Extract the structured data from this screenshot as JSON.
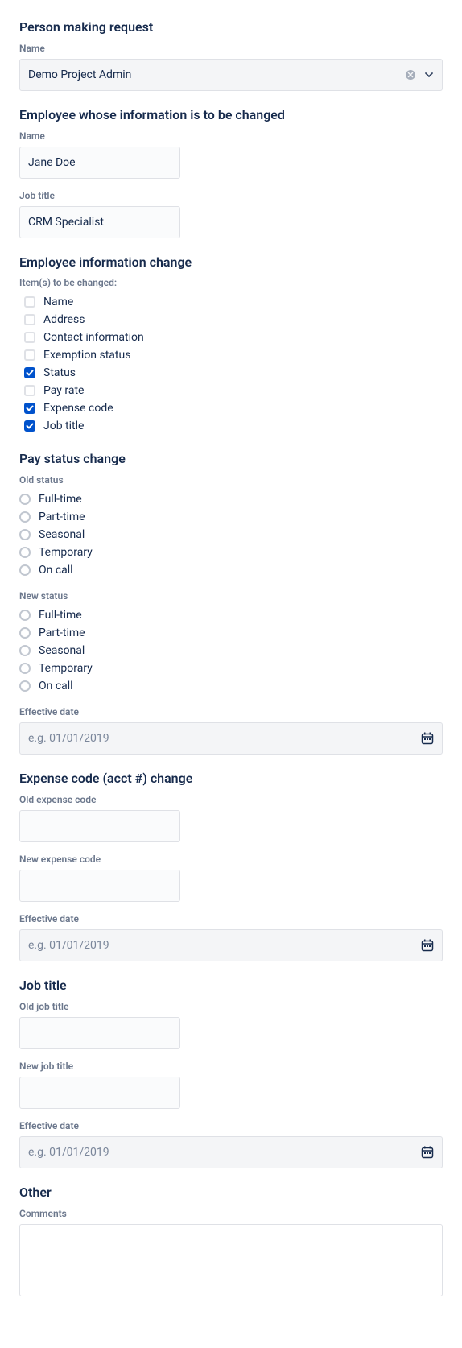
{
  "sections": {
    "requester": {
      "title": "Person making request",
      "name_label": "Name",
      "name_value": "Demo Project Admin"
    },
    "employee": {
      "title": "Employee whose information is to be changed",
      "name_label": "Name",
      "name_value": "Jane Doe",
      "job_title_label": "Job title",
      "job_title_value": "CRM Specialist"
    },
    "info_change": {
      "title": "Employee information change",
      "items_label": "Item(s) to be changed:",
      "items": [
        {
          "label": "Name",
          "checked": false
        },
        {
          "label": "Address",
          "checked": false
        },
        {
          "label": "Contact information",
          "checked": false
        },
        {
          "label": "Exemption status",
          "checked": false
        },
        {
          "label": "Status",
          "checked": true
        },
        {
          "label": "Pay rate",
          "checked": false
        },
        {
          "label": "Expense code",
          "checked": true
        },
        {
          "label": "Job title",
          "checked": true
        }
      ]
    },
    "pay_status": {
      "title": "Pay status change",
      "old_label": "Old status",
      "new_label": "New status",
      "options": [
        "Full-time",
        "Part-time",
        "Seasonal",
        "Temporary",
        "On call"
      ],
      "effective_label": "Effective date",
      "effective_placeholder": "e.g. 01/01/2019"
    },
    "expense": {
      "title": "Expense code (acct #) change",
      "old_label": "Old expense code",
      "new_label": "New expense code",
      "effective_label": "Effective date",
      "effective_placeholder": "e.g. 01/01/2019"
    },
    "job_title": {
      "title": "Job title",
      "old_label": "Old job title",
      "new_label": "New job title",
      "effective_label": "Effective date",
      "effective_placeholder": "e.g. 01/01/2019"
    },
    "other": {
      "title": "Other",
      "comments_label": "Comments"
    }
  }
}
